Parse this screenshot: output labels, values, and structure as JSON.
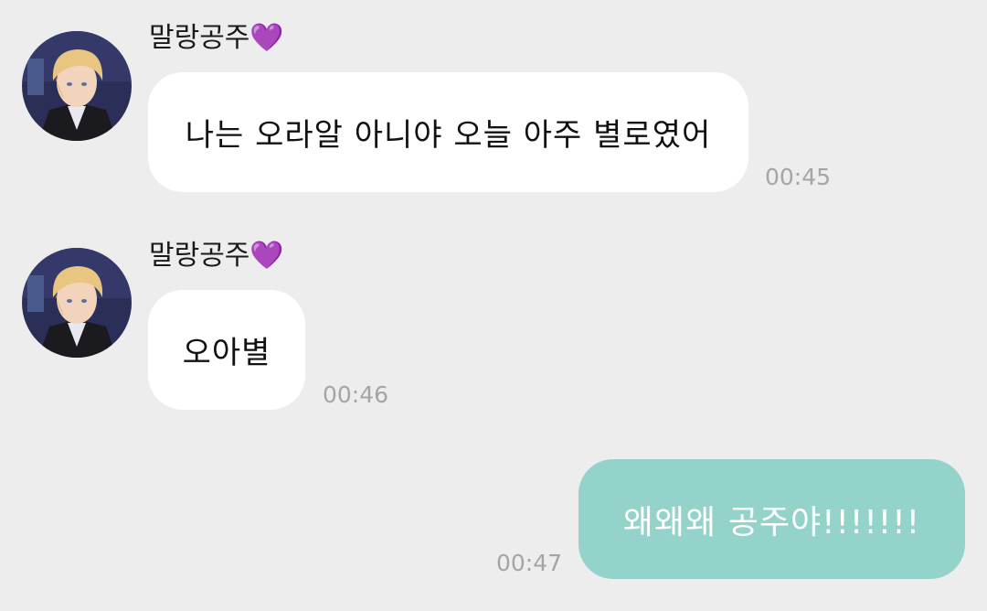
{
  "messages": [
    {
      "direction": "incoming",
      "sender": "말랑공주💜",
      "text": "나는 오라알 아니야 오늘 아주 별로였어",
      "time": "00:45",
      "avatar": "anime-blond-man-avatar"
    },
    {
      "direction": "incoming",
      "sender": "말랑공주💜",
      "text": "오아별",
      "time": "00:46",
      "avatar": "anime-blond-man-avatar"
    },
    {
      "direction": "outgoing",
      "text": "왜왜왜 공주야!!!!!!!",
      "time": "00:47"
    }
  ],
  "colors": {
    "background": "#ededed",
    "incoming_bubble": "#ffffff",
    "outgoing_bubble": "#94d3c9",
    "timestamp": "#a5a5a5"
  }
}
